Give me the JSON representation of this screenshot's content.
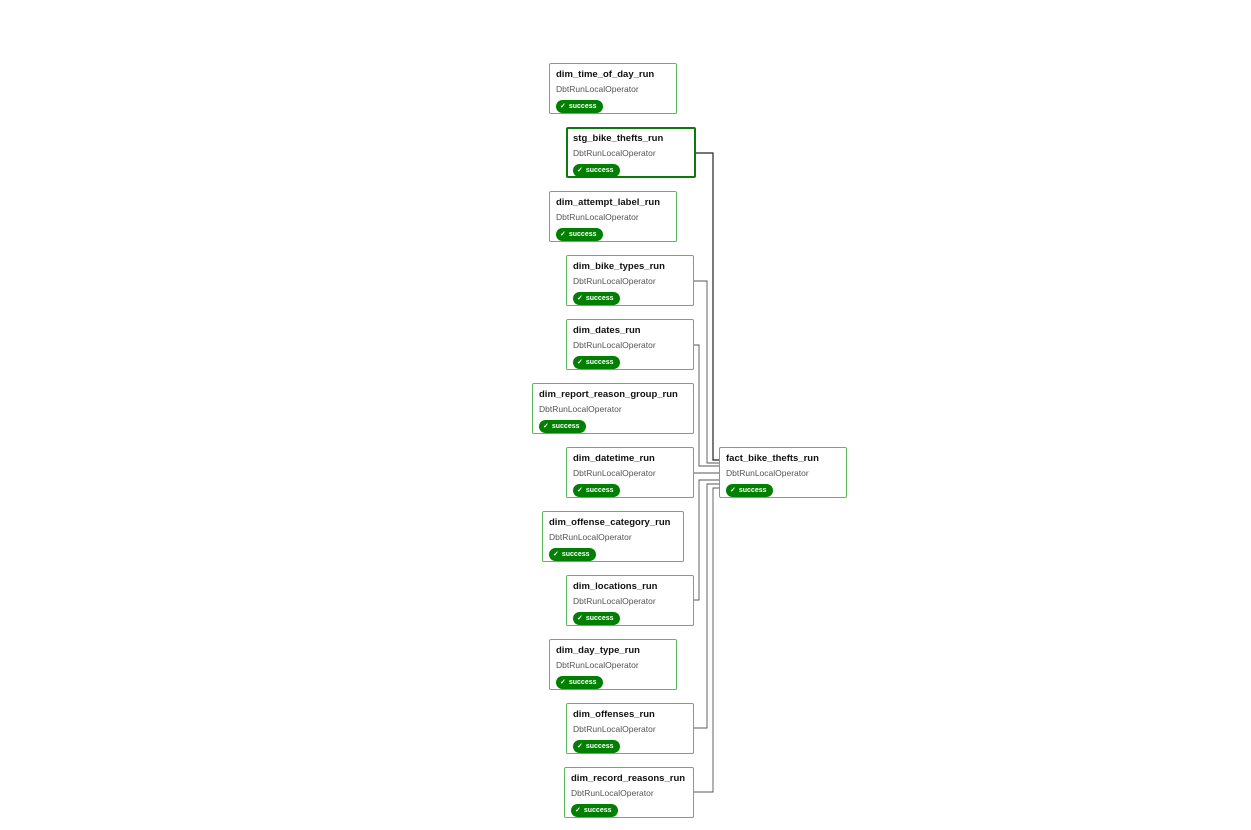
{
  "theme": {
    "node_border": "#5cb85c",
    "selected_border": "#0b7a0b",
    "badge_color": "#008000",
    "edge_color": "#555555"
  },
  "nodes": [
    {
      "id": "dim_time_of_day_run",
      "title": "dim_time_of_day_run",
      "operator": "DbtRunLocalOperator",
      "status": "success",
      "status_icon": "check-icon",
      "selected": false
    },
    {
      "id": "stg_bike_thefts_run",
      "title": "stg_bike_thefts_run",
      "operator": "DbtRunLocalOperator",
      "status": "success",
      "status_icon": "check-icon",
      "selected": true
    },
    {
      "id": "dim_attempt_label_run",
      "title": "dim_attempt_label_run",
      "operator": "DbtRunLocalOperator",
      "status": "success",
      "status_icon": "check-icon",
      "selected": false
    },
    {
      "id": "dim_bike_types_run",
      "title": "dim_bike_types_run",
      "operator": "DbtRunLocalOperator",
      "status": "success",
      "status_icon": "check-icon",
      "selected": false
    },
    {
      "id": "dim_dates_run",
      "title": "dim_dates_run",
      "operator": "DbtRunLocalOperator",
      "status": "success",
      "status_icon": "check-icon",
      "selected": false
    },
    {
      "id": "dim_report_reason_group_run",
      "title": "dim_report_reason_group_run",
      "operator": "DbtRunLocalOperator",
      "status": "success",
      "status_icon": "check-icon",
      "selected": false
    },
    {
      "id": "dim_datetime_run",
      "title": "dim_datetime_run",
      "operator": "DbtRunLocalOperator",
      "status": "success",
      "status_icon": "check-icon",
      "selected": false
    },
    {
      "id": "dim_offense_category_run",
      "title": "dim_offense_category_run",
      "operator": "DbtRunLocalOperator",
      "status": "success",
      "status_icon": "check-icon",
      "selected": false
    },
    {
      "id": "dim_locations_run",
      "title": "dim_locations_run",
      "operator": "DbtRunLocalOperator",
      "status": "success",
      "status_icon": "check-icon",
      "selected": false
    },
    {
      "id": "dim_day_type_run",
      "title": "dim_day_type_run",
      "operator": "DbtRunLocalOperator",
      "status": "success",
      "status_icon": "check-icon",
      "selected": false
    },
    {
      "id": "dim_offenses_run",
      "title": "dim_offenses_run",
      "operator": "DbtRunLocalOperator",
      "status": "success",
      "status_icon": "check-icon",
      "selected": false
    },
    {
      "id": "dim_record_reasons_run",
      "title": "dim_record_reasons_run",
      "operator": "DbtRunLocalOperator",
      "status": "success",
      "status_icon": "check-icon",
      "selected": false
    },
    {
      "id": "fact_bike_thefts_run",
      "title": "fact_bike_thefts_run",
      "operator": "DbtRunLocalOperator",
      "status": "success",
      "status_icon": "check-icon",
      "selected": false
    }
  ],
  "edges": [
    {
      "from": "stg_bike_thefts_run",
      "to": "fact_bike_thefts_run"
    },
    {
      "from": "dim_bike_types_run",
      "to": "fact_bike_thefts_run"
    },
    {
      "from": "dim_dates_run",
      "to": "fact_bike_thefts_run"
    },
    {
      "from": "dim_datetime_run",
      "to": "fact_bike_thefts_run"
    },
    {
      "from": "dim_locations_run",
      "to": "fact_bike_thefts_run"
    },
    {
      "from": "dim_offenses_run",
      "to": "fact_bike_thefts_run"
    },
    {
      "from": "dim_record_reasons_run",
      "to": "fact_bike_thefts_run"
    }
  ]
}
